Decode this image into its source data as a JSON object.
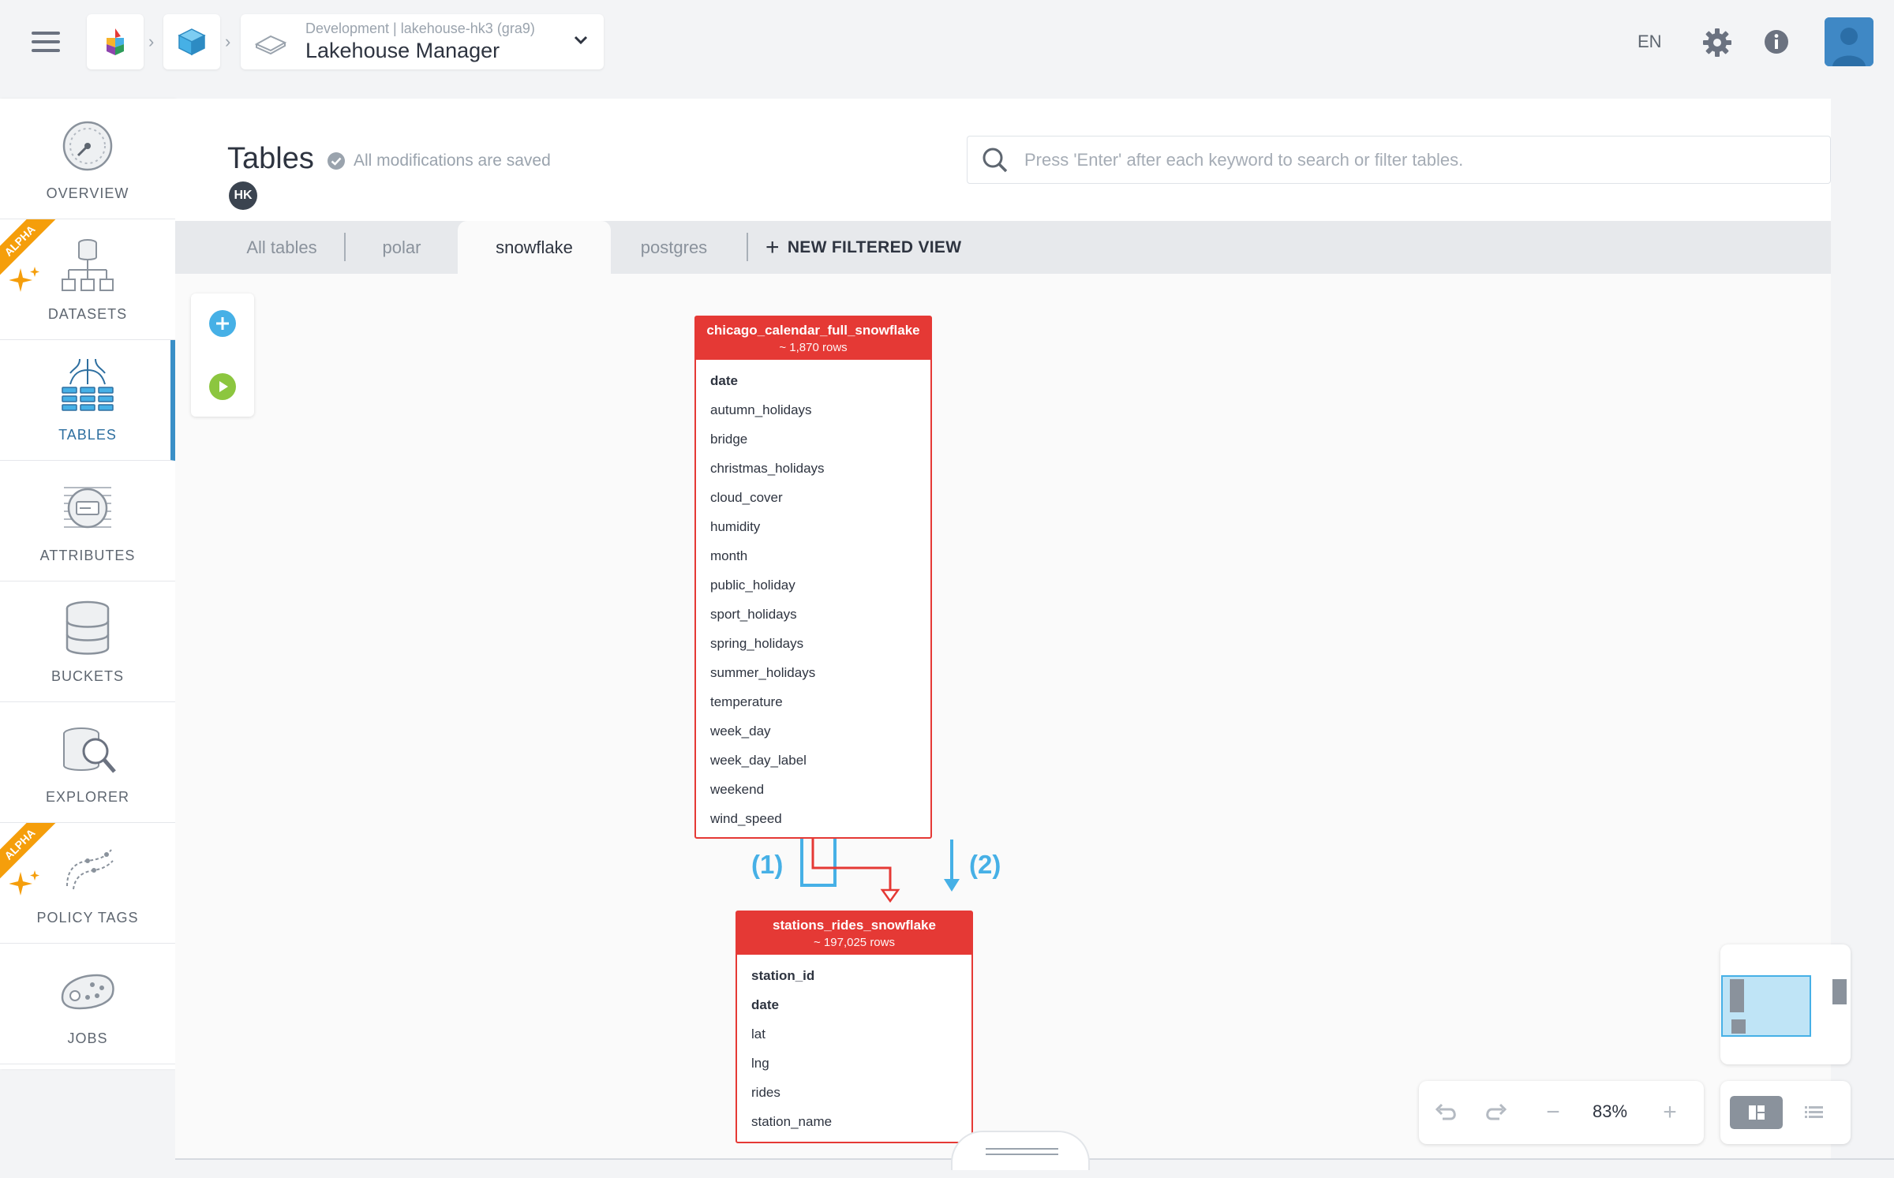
{
  "topbar": {
    "project_sub": "Development | lakehouse-hk3 (gra9)",
    "project_name": "Lakehouse Manager",
    "language": "EN",
    "icons": [
      "menu-icon",
      "app-logo-icon",
      "lakehouse-cube-icon",
      "cloud-platform-icon",
      "chevron-down-icon",
      "gear-icon",
      "info-icon",
      "user-avatar"
    ]
  },
  "sidebar": {
    "items": [
      {
        "label": "OVERVIEW",
        "icon": "gauge-icon",
        "alpha": false
      },
      {
        "label": "DATASETS",
        "icon": "dataset-tree-icon",
        "alpha": true
      },
      {
        "label": "TABLES",
        "icon": "tables-icon",
        "alpha": false,
        "active": true
      },
      {
        "label": "ATTRIBUTES",
        "icon": "attributes-icon",
        "alpha": false
      },
      {
        "label": "BUCKETS",
        "icon": "database-icon",
        "alpha": false
      },
      {
        "label": "EXPLORER",
        "icon": "explorer-magnifier-icon",
        "alpha": false
      },
      {
        "label": "POLICY TAGS",
        "icon": "policy-tags-icon",
        "alpha": true
      },
      {
        "label": "JOBS",
        "icon": "jobs-icon",
        "alpha": false
      }
    ],
    "alpha_label": "ALPHA"
  },
  "header": {
    "title": "Tables",
    "saved_status": "All modifications are saved",
    "user_badge": "HK",
    "search_placeholder": "Press 'Enter' after each keyword to search or filter tables."
  },
  "tabs": [
    {
      "label": "All tables",
      "active": false
    },
    {
      "label": "polar",
      "active": false
    },
    {
      "label": "snowflake",
      "active": true
    },
    {
      "label": "postgres",
      "active": false
    }
  ],
  "new_view_label": "NEW FILTERED VIEW",
  "tables": [
    {
      "name": "chicago_calendar_full_snowflake",
      "rows": "~ 1,870 rows",
      "fields": [
        {
          "name": "date",
          "key": true
        },
        {
          "name": "autumn_holidays",
          "key": false
        },
        {
          "name": "bridge",
          "key": false
        },
        {
          "name": "christmas_holidays",
          "key": false
        },
        {
          "name": "cloud_cover",
          "key": false
        },
        {
          "name": "humidity",
          "key": false
        },
        {
          "name": "month",
          "key": false
        },
        {
          "name": "public_holiday",
          "key": false
        },
        {
          "name": "sport_holidays",
          "key": false
        },
        {
          "name": "spring_holidays",
          "key": false
        },
        {
          "name": "summer_holidays",
          "key": false
        },
        {
          "name": "temperature",
          "key": false
        },
        {
          "name": "week_day",
          "key": false
        },
        {
          "name": "week_day_label",
          "key": false
        },
        {
          "name": "weekend",
          "key": false
        },
        {
          "name": "wind_speed",
          "key": false
        }
      ]
    },
    {
      "name": "stations_rides_snowflake",
      "rows": "~ 197,025 rows",
      "fields": [
        {
          "name": "station_id",
          "key": true
        },
        {
          "name": "date",
          "key": true
        },
        {
          "name": "lat",
          "key": false
        },
        {
          "name": "lng",
          "key": false
        },
        {
          "name": "rides",
          "key": false
        },
        {
          "name": "station_name",
          "key": false
        }
      ]
    }
  ],
  "annotations": {
    "one": "(1)",
    "two": "(2)"
  },
  "zoom": {
    "level": "83%"
  },
  "colors": {
    "table_header": "#e53935",
    "accent": "#3a8fc7",
    "annotation": "#46b0e6",
    "alpha_badge": "#f59e0b"
  }
}
